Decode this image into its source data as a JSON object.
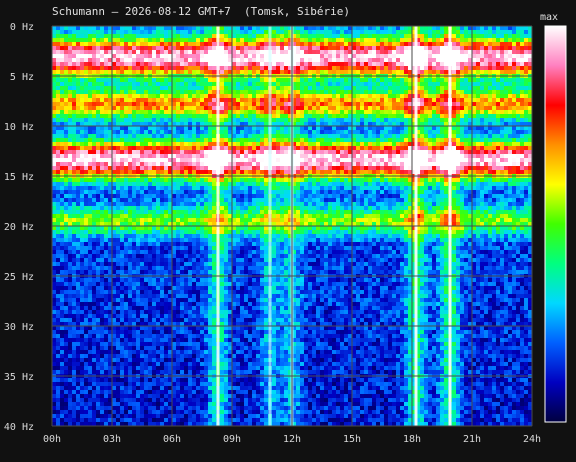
{
  "title": "Schumann – 2026-08-12 GMT+7  (Tomsk, Sibérie)",
  "colorbar": {
    "max_label": "max",
    "colors": [
      "#000040",
      "#0000c0",
      "#0060ff",
      "#00d8ff",
      "#00ff80",
      "#40ff00",
      "#ffff00",
      "#ff9000",
      "#ff0000",
      "#ff80c0",
      "#ffffff"
    ]
  },
  "chart_data": {
    "type": "heatmap",
    "title": "Schumann – 2026-08-12 GMT+7  (Tomsk, Sibérie)",
    "x_tick_labels": [
      "00h",
      "03h",
      "06h",
      "09h",
      "12h",
      "15h",
      "18h",
      "21h",
      "24h"
    ],
    "y_tick_labels": [
      "0 Hz",
      "5 Hz",
      "10 Hz",
      "15 Hz",
      "20 Hz",
      "25 Hz",
      "30 Hz",
      "35 Hz",
      "40 Hz"
    ],
    "x_range_hours": [
      0,
      24
    ],
    "y_range_hz": [
      0,
      40
    ],
    "grid": true,
    "bands_hz": [
      {
        "center": 2.5,
        "intensity": 0.55
      },
      {
        "center": 4.0,
        "intensity": 0.45
      },
      {
        "center": 7.8,
        "intensity": 0.5
      },
      {
        "center": 12.8,
        "intensity": 0.6
      },
      {
        "center": 14.3,
        "intensity": 0.45
      },
      {
        "center": 19.5,
        "intensity": 0.35
      }
    ],
    "vertical_events_hours": [
      {
        "time": 8.3,
        "intensity": 0.9
      },
      {
        "time": 10.9,
        "intensity": 0.55
      },
      {
        "time": 12.0,
        "intensity": 0.6
      },
      {
        "time": 18.2,
        "intensity": 1.0
      },
      {
        "time": 19.9,
        "intensity": 1.0
      }
    ]
  }
}
